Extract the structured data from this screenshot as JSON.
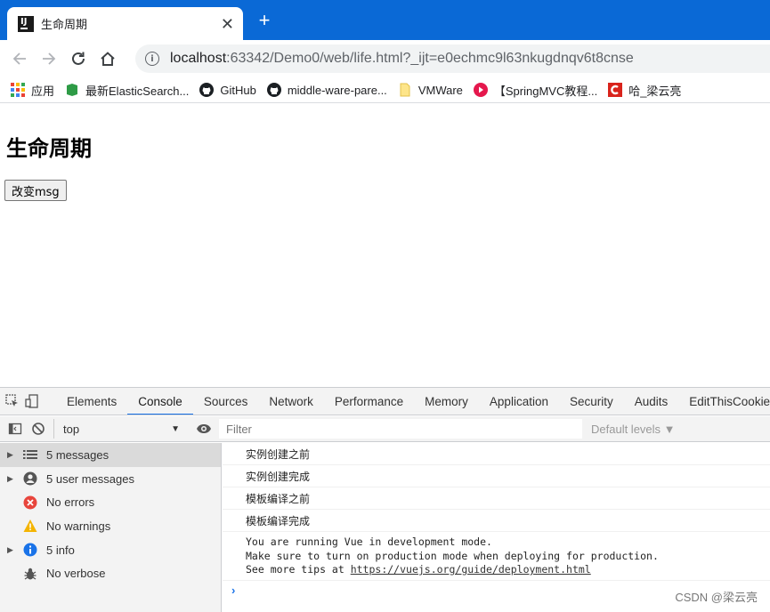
{
  "tab": {
    "title": "生命周期",
    "close_glyph": "✕",
    "new_tab_glyph": "+"
  },
  "toolbar": {
    "url_host": "localhost",
    "url_rest": ":63342/Demo0/web/life.html?_ijt=e0echmc9l63nkugdnqv6t8cnse"
  },
  "bookmarks": [
    {
      "label": "应用",
      "icon": "apps-grid-icon"
    },
    {
      "label": "最新ElasticSearch...",
      "icon": "green-bookmark-icon"
    },
    {
      "label": "GitHub",
      "icon": "github-icon"
    },
    {
      "label": "middle-ware-pare...",
      "icon": "github-icon"
    },
    {
      "label": "VMWare",
      "icon": "folder-icon"
    },
    {
      "label": "【SpringMVC教程...",
      "icon": "red-circle-icon"
    },
    {
      "label": "哈_梁云亮",
      "icon": "csdn-icon"
    }
  ],
  "page": {
    "heading": "生命周期",
    "button_label": "改变msg"
  },
  "devtools": {
    "tabs": [
      "Elements",
      "Console",
      "Sources",
      "Network",
      "Performance",
      "Memory",
      "Application",
      "Security",
      "Audits",
      "EditThisCookie"
    ],
    "active_tab": "Console",
    "context": "top",
    "filter_placeholder": "Filter",
    "levels_label": "Default levels ▼",
    "sidebar": [
      {
        "label": "5 messages",
        "icon": "list-icon",
        "expandable": true
      },
      {
        "label": "5 user messages",
        "icon": "user-icon",
        "expandable": true
      },
      {
        "label": "No errors",
        "icon": "error-icon",
        "expandable": false
      },
      {
        "label": "No warnings",
        "icon": "warning-icon",
        "expandable": false
      },
      {
        "label": "5 info",
        "icon": "info-icon",
        "expandable": true
      },
      {
        "label": "No verbose",
        "icon": "bug-icon",
        "expandable": false
      }
    ],
    "messages": [
      "实例创建之前",
      "实例创建完成",
      "模板编译之前",
      "模板编译完成"
    ],
    "vue_notice": {
      "line1": "You are running Vue in development mode.",
      "line2": "Make sure to turn on production mode when deploying for production.",
      "line3_prefix": "See more tips at ",
      "link": "https://vuejs.org/guide/deployment.html"
    },
    "prompt_glyph": "›"
  },
  "watermark": "CSDN @梁云亮",
  "colors": {
    "tabstrip": "#0a69d6",
    "accent": "#1a73e8",
    "error": "#e8453c",
    "warning": "#f4b400",
    "info": "#1a73e8"
  }
}
